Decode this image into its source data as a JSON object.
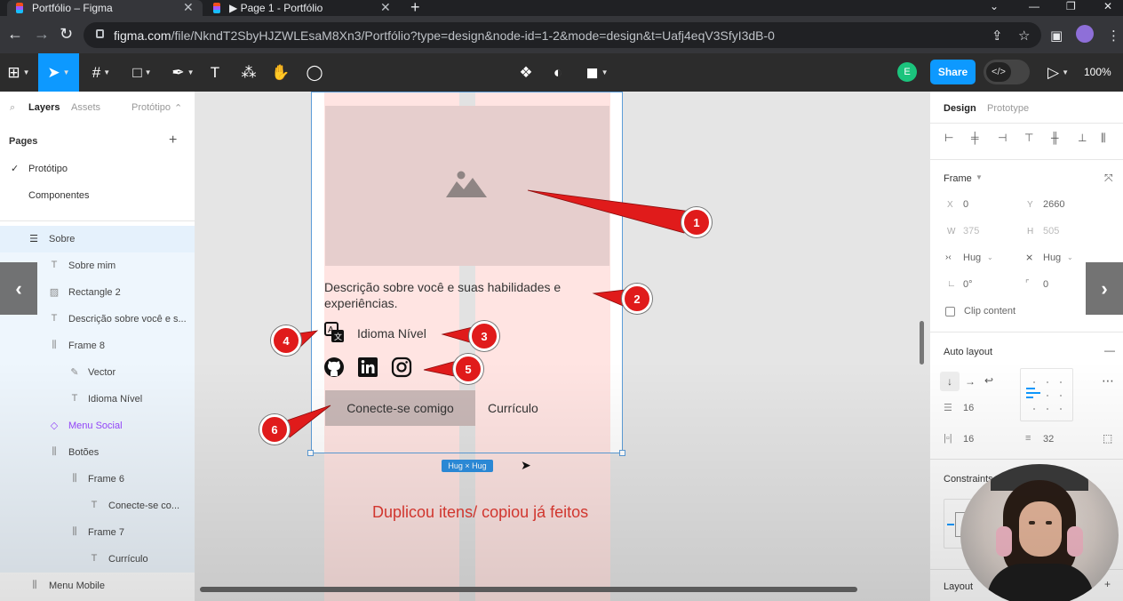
{
  "browser": {
    "tabs": [
      {
        "title": "Portfólio – Figma",
        "active": true
      },
      {
        "title": "▶ Page 1 - Portfólio",
        "active": false
      }
    ],
    "url_domain": "figma.com",
    "url_path": "/file/NkndT2SbyHJZWLEsaM8Xn3/Portfólio?type=design&node-id=1-2&mode=design&t=Uafj4eqV3SfyI3dB-0"
  },
  "toolbar": {
    "avatar_initial": "E",
    "share_label": "Share",
    "zoom": "100%"
  },
  "left_panel": {
    "tabs": {
      "layers": "Layers",
      "assets": "Assets",
      "page_name": "Protótipo"
    },
    "pages_title": "Pages",
    "pages": [
      "Protótipo",
      "Componentes"
    ],
    "layers": [
      {
        "label": "Sobre",
        "icon": "frame-icon"
      },
      {
        "label": "Sobre mim",
        "icon": "text-icon"
      },
      {
        "label": "Rectangle 2",
        "icon": "image-icon"
      },
      {
        "label": "Descrição sobre você e s...",
        "icon": "text-icon"
      },
      {
        "label": "Frame 8",
        "icon": "autolayout-icon"
      },
      {
        "label": "Vector",
        "icon": "vector-icon"
      },
      {
        "label": "Idioma Nível",
        "icon": "text-icon"
      },
      {
        "label": "Menu Social",
        "icon": "component-icon"
      },
      {
        "label": "Botões",
        "icon": "autolayout-icon"
      },
      {
        "label": "Frame 6",
        "icon": "autolayout-icon"
      },
      {
        "label": "Conecte-se co...",
        "icon": "text-icon"
      },
      {
        "label": "Frame 7",
        "icon": "autolayout-icon"
      },
      {
        "label": "Currículo",
        "icon": "text-icon"
      },
      {
        "label": "Menu Mobile",
        "icon": "autolayout-icon"
      }
    ]
  },
  "canvas": {
    "description": "Descrição sobre você e suas habilidades e experiências.",
    "language_label": "Idioma Nível",
    "button_primary": "Conecte-se comigo",
    "button_secondary": "Currículo",
    "size_badge": "Hug × Hug",
    "caption": "Duplicou itens/ copiou já feitos"
  },
  "right_panel": {
    "tabs": {
      "design": "Design",
      "prototype": "Prototype"
    },
    "frame_title": "Frame",
    "x_label": "X",
    "x_value": "0",
    "y_label": "Y",
    "y_value": "2660",
    "w_label": "W",
    "w_value": "375",
    "h_label": "H",
    "h_value": "505",
    "width_mode": "Hug",
    "height_mode": "Hug",
    "rotation": "0°",
    "radius": "0",
    "clip_content": "Clip content",
    "autolayout_title": "Auto layout",
    "gap": "16",
    "padding_h": "16",
    "padding_v": "32",
    "constraints_title": "Constraints",
    "layout_grid_title": "Layout"
  },
  "annotations": [
    "1",
    "2",
    "3",
    "4",
    "5",
    "6"
  ],
  "colors": {
    "accent": "#0d99ff",
    "annotation": "#e01b1b",
    "caption": "#e23a32",
    "layout_grid": "#fde3e1"
  }
}
